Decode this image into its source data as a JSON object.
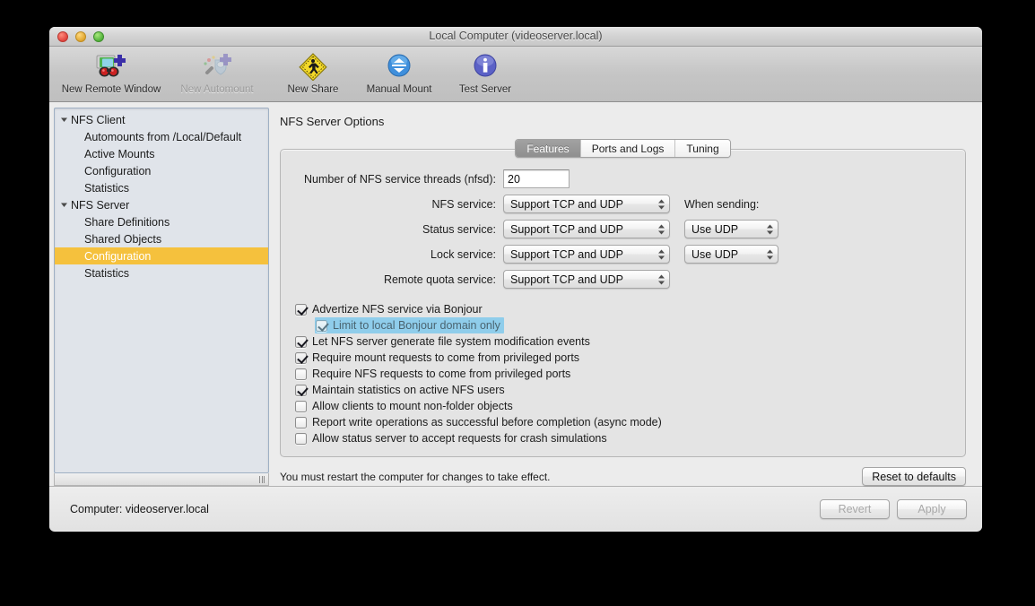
{
  "window": {
    "title": "Local Computer (videoserver.local)",
    "traffic_lights": [
      "close-button",
      "minimize-button",
      "zoom-button"
    ]
  },
  "toolbar": {
    "items": [
      {
        "label": "New Remote Window",
        "icon": "new-remote-window-icon",
        "disabled": false
      },
      {
        "label": "New Automount",
        "icon": "new-automount-icon",
        "disabled": true
      },
      {
        "label": "New Share",
        "icon": "new-share-icon",
        "disabled": false
      },
      {
        "label": "Manual Mount",
        "icon": "manual-mount-icon",
        "disabled": false
      },
      {
        "label": "Test Server",
        "icon": "test-server-icon",
        "disabled": false
      }
    ]
  },
  "sidebar": {
    "items": [
      {
        "label": "NFS Client",
        "level": 0,
        "expanded": true,
        "selected": false
      },
      {
        "label": "Automounts from /Local/Default",
        "level": 1,
        "selected": false
      },
      {
        "label": "Active Mounts",
        "level": 1,
        "selected": false
      },
      {
        "label": "Configuration",
        "level": 1,
        "selected": false
      },
      {
        "label": "Statistics",
        "level": 1,
        "selected": false
      },
      {
        "label": "NFS Server",
        "level": 0,
        "expanded": true,
        "selected": false
      },
      {
        "label": "Share Definitions",
        "level": 1,
        "selected": false
      },
      {
        "label": "Shared Objects",
        "level": 1,
        "selected": false
      },
      {
        "label": "Configuration",
        "level": 1,
        "selected": true
      },
      {
        "label": "Statistics",
        "level": 1,
        "selected": false
      }
    ],
    "selection_color": "#f5c13d"
  },
  "main": {
    "pane_title": "NFS Server Options",
    "tabs": [
      {
        "label": "Features",
        "active": true
      },
      {
        "label": "Ports and Logs",
        "active": false
      },
      {
        "label": "Tuning",
        "active": false
      }
    ],
    "threads": {
      "label": "Number of NFS service threads (nfsd):",
      "value": "20"
    },
    "when_sending_label": "When sending:",
    "service_rows": [
      {
        "label": "NFS service:",
        "protocol": "Support TCP and UDP",
        "sending": null
      },
      {
        "label": "Status service:",
        "protocol": "Support TCP and UDP",
        "sending": "Use UDP"
      },
      {
        "label": "Lock service:",
        "protocol": "Support TCP and UDP",
        "sending": "Use UDP"
      },
      {
        "label": "Remote quota service:",
        "protocol": "Support TCP and UDP",
        "sending": null
      }
    ],
    "checkboxes": [
      {
        "label": "Advertize NFS service via Bonjour",
        "checked": true,
        "indent": false,
        "highlighted": false
      },
      {
        "label": "Limit to local Bonjour domain only",
        "checked": true,
        "indent": true,
        "highlighted": true
      },
      {
        "label": "Let NFS server generate file system modification events",
        "checked": true,
        "indent": false,
        "highlighted": false
      },
      {
        "label": "Require mount requests to come from privileged ports",
        "checked": true,
        "indent": false,
        "highlighted": false
      },
      {
        "label": "Require NFS requests to come from privileged ports",
        "checked": false,
        "indent": false,
        "highlighted": false
      },
      {
        "label": "Maintain statistics on active NFS users",
        "checked": true,
        "indent": false,
        "highlighted": false
      },
      {
        "label": "Allow clients to mount non-folder objects",
        "checked": false,
        "indent": false,
        "highlighted": false
      },
      {
        "label": "Report write operations as successful before completion (async mode)",
        "checked": false,
        "indent": false,
        "highlighted": false
      },
      {
        "label": "Allow status server to accept requests for crash simulations",
        "checked": false,
        "indent": false,
        "highlighted": false
      }
    ],
    "restart_note": "You must restart the computer for changes to take effect.",
    "reset_button": "Reset to defaults"
  },
  "bottom": {
    "computer_label": "Computer: videoserver.local",
    "revert_button": "Revert",
    "apply_button": "Apply",
    "revert_disabled": true,
    "apply_disabled": true
  },
  "colors": {
    "sidebar_selection": "#f5c13d",
    "row_highlight": "#8fcdeb",
    "tab_active": "#959595"
  }
}
